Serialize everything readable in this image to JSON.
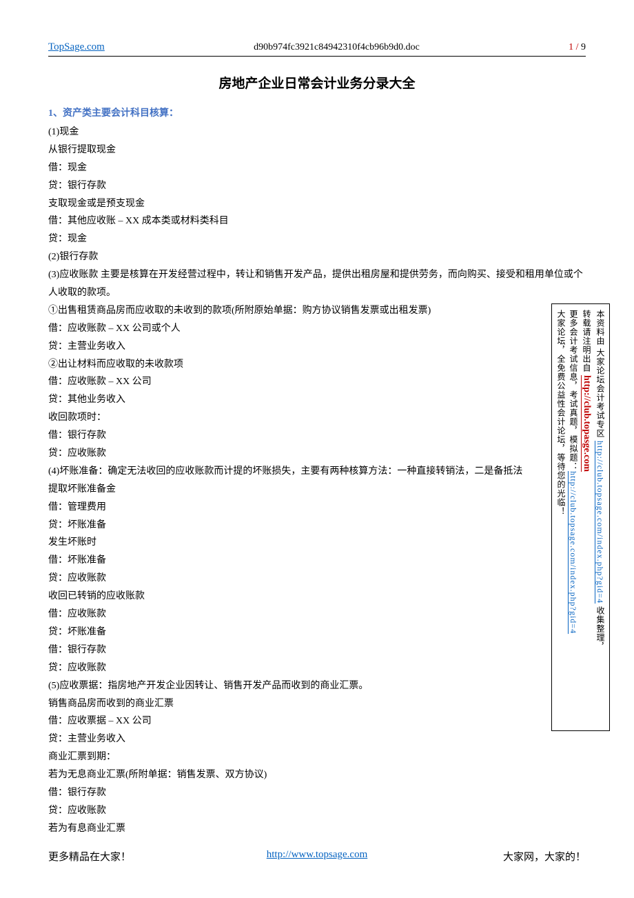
{
  "header": {
    "site": "TopSage.com",
    "filename": "d90b974fc3921c84942310f4cb96b9d0.doc",
    "page_current": "1",
    "page_sep": " / ",
    "page_total": "9"
  },
  "title": "房地产企业日常会计业务分录大全",
  "section_heading": "1、资产类主要会计科目核算：",
  "body": [
    "(1)现金",
    "从银行提取现金",
    "借：现金",
    "贷：银行存款",
    "支取现金或是预支现金",
    "借：其他应收账 – XX 成本类或材料类科目",
    "贷：现金",
    "(2)银行存款",
    "(3)应收账款 主要是核算在开发经营过程中，转让和销售开发产品，提供出租房屋和提供劳务，而向购买、接受和租用单位或个人收取的款项。",
    "①出售租赁商品房而应收取的未收到的款项(所附原始单据：购方协议销售发票或出租发票)",
    "借：应收账款 – XX 公司或个人",
    "贷：主营业务收入",
    "②出让材料而应收取的未收款项",
    "借：应收账款 – XX 公司",
    "贷：其他业务收入",
    "收回款项时：",
    "借：银行存款",
    "贷：应收账款",
    "(4)坏账准备：确定无法收回的应收账款而计提的坏账损失，主要有两种核算方法：一种直接转销法，二是备抵法",
    "提取坏账准备金",
    "借：管理费用",
    "贷：坏账准备",
    "发生坏账时",
    "借：坏账准备",
    "贷：应收账款",
    "收回已转销的应收账款",
    "借：应收账款",
    "贷：坏账准备",
    "借：银行存款",
    "贷：应收账款",
    "(5)应收票据：指房地产开发企业因转让、销售开发产品而收到的商业汇票。",
    "销售商品房而收到的商业汇票",
    "借：应收票据 – XX 公司",
    "贷：主营业务收入",
    "商业汇票到期：",
    "若为无息商业汇票(所附单据：销售发票、双方协议)",
    "借：银行存款",
    "贷：应收账款",
    "若为有息商业汇票"
  ],
  "sidebar": {
    "col1_a": "本资料由  大家论坛会计考试专区 ",
    "col1_link": "http://club.topsage.com/index.php?gid=4",
    "col1_b": "  收集整理，",
    "col2_a": "转载请注明出自  ",
    "col2_link": "http://club.topasge.com",
    "col3_a": "更多会计考试信息，考试真题，模拟题：",
    "col3_link": "http://club.topsage.com/index.php?gid=4",
    "col4": "大家论坛，全免费公益性会计论坛，等待您的光临！"
  },
  "footer": {
    "left": "更多精品在大家！",
    "center": "http://www.topsage.com",
    "right": "大家网，大家的！"
  }
}
